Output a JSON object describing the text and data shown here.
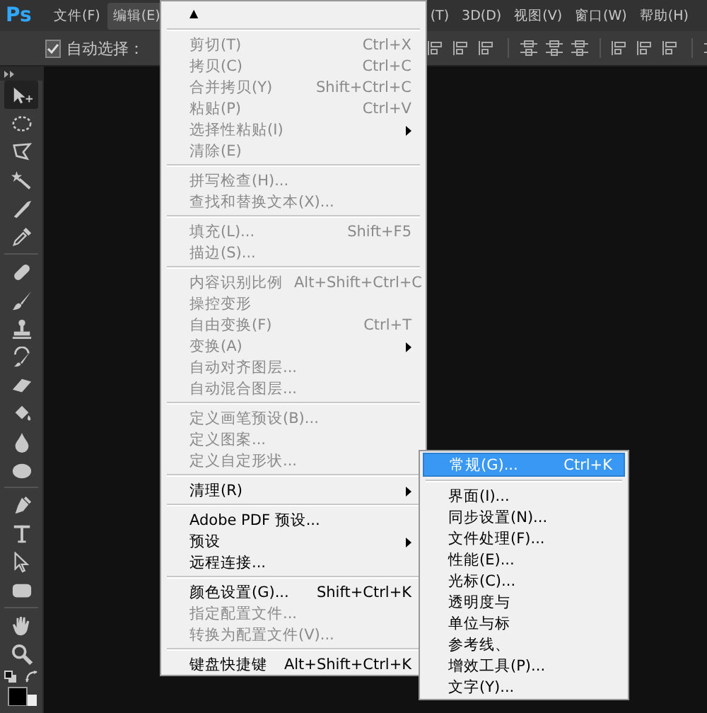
{
  "app_logo": "Ps",
  "menu_bar": {
    "left": [
      {
        "label": "文件(F)",
        "selected": false
      },
      {
        "label": "编辑(E)",
        "selected": true
      }
    ],
    "right": [
      {
        "label": "(T)",
        "selected": false
      },
      {
        "label": "3D(D)",
        "selected": false
      },
      {
        "label": "视图(V)",
        "selected": false
      },
      {
        "label": "窗口(W)",
        "selected": false
      },
      {
        "label": "帮助(H)",
        "selected": false
      }
    ]
  },
  "options_bar": {
    "auto_select": {
      "label": "自动选择：",
      "checked": true
    }
  },
  "tools": [
    {
      "kind": "move",
      "selected": true
    },
    {
      "kind": "marquee",
      "selected": false
    },
    {
      "kind": "lasso",
      "selected": false
    },
    {
      "kind": "wand",
      "selected": false
    },
    {
      "kind": "knife",
      "selected": false
    },
    {
      "kind": "eyedropper",
      "selected": false
    },
    {
      "kind": "separator"
    },
    {
      "kind": "bandage",
      "selected": false
    },
    {
      "kind": "brush",
      "selected": false
    },
    {
      "kind": "stamp",
      "selected": false
    },
    {
      "kind": "history",
      "selected": false
    },
    {
      "kind": "eraser",
      "selected": false
    },
    {
      "kind": "bucket",
      "selected": false
    },
    {
      "kind": "drop",
      "selected": false
    },
    {
      "kind": "sponge",
      "selected": false
    },
    {
      "kind": "separator"
    },
    {
      "kind": "pen",
      "selected": false
    },
    {
      "kind": "type",
      "selected": false
    },
    {
      "kind": "pointer",
      "selected": false
    },
    {
      "kind": "shape",
      "selected": false
    },
    {
      "kind": "separator"
    },
    {
      "kind": "hand",
      "selected": false
    },
    {
      "kind": "zoom",
      "selected": false
    }
  ],
  "edit_menu": {
    "scroll_arrow": "▲",
    "items": [
      {
        "kind": "item",
        "label": "剪切(T)",
        "shortcut": "Ctrl+X",
        "disabled": true
      },
      {
        "kind": "item",
        "label": "拷贝(C)",
        "shortcut": "Ctrl+C",
        "disabled": true
      },
      {
        "kind": "item",
        "label": "合并拷贝(Y)",
        "shortcut": "Shift+Ctrl+C",
        "disabled": true
      },
      {
        "kind": "item",
        "label": "粘贴(P)",
        "shortcut": "Ctrl+V",
        "disabled": true
      },
      {
        "kind": "submenu",
        "label": "选择性粘贴(I)",
        "disabled": true
      },
      {
        "kind": "item",
        "label": "清除(E)",
        "disabled": true
      },
      {
        "kind": "separator"
      },
      {
        "kind": "item",
        "label": "拼写检查(H)...",
        "disabled": true
      },
      {
        "kind": "item",
        "label": "查找和替换文本(X)...",
        "disabled": true
      },
      {
        "kind": "separator"
      },
      {
        "kind": "item",
        "label": "填充(L)...",
        "shortcut": "Shift+F5",
        "disabled": true
      },
      {
        "kind": "item",
        "label": "描边(S)...",
        "disabled": true
      },
      {
        "kind": "separator"
      },
      {
        "kind": "item",
        "label": "内容识别比例",
        "shortcut": "Alt+Shift+Ctrl+C",
        "disabled": true
      },
      {
        "kind": "item",
        "label": "操控变形",
        "disabled": true
      },
      {
        "kind": "item",
        "label": "自由变换(F)",
        "shortcut": "Ctrl+T",
        "disabled": true
      },
      {
        "kind": "submenu",
        "label": "变换(A)",
        "disabled": true
      },
      {
        "kind": "item",
        "label": "自动对齐图层...",
        "disabled": true
      },
      {
        "kind": "item",
        "label": "自动混合图层...",
        "disabled": true
      },
      {
        "kind": "separator"
      },
      {
        "kind": "item",
        "label": "定义画笔预设(B)...",
        "disabled": true
      },
      {
        "kind": "item",
        "label": "定义图案...",
        "disabled": true
      },
      {
        "kind": "item",
        "label": "定义自定形状...",
        "disabled": true
      },
      {
        "kind": "separator"
      },
      {
        "kind": "submenu",
        "label": "清理(R)",
        "disabled": false
      },
      {
        "kind": "separator"
      },
      {
        "kind": "item",
        "label": "Adobe PDF 预设...",
        "disabled": false
      },
      {
        "kind": "submenu",
        "label": "预设",
        "disabled": false
      },
      {
        "kind": "item",
        "label": "远程连接...",
        "disabled": false
      },
      {
        "kind": "separator"
      },
      {
        "kind": "item",
        "label": "颜色设置(G)...",
        "shortcut": "Shift+Ctrl+K",
        "disabled": false
      },
      {
        "kind": "item",
        "label": "指定配置文件...",
        "disabled": true
      },
      {
        "kind": "item",
        "label": "转换为配置文件(V)...",
        "disabled": true
      },
      {
        "kind": "separator"
      },
      {
        "kind": "item",
        "label": "键盘快捷键",
        "shortcut": "Alt+Shift+Ctrl+K",
        "disabled": false
      }
    ]
  },
  "preferences_submenu": {
    "items": [
      {
        "kind": "item",
        "label": "常规(G)...",
        "shortcut": "Ctrl+K",
        "selected": true
      },
      {
        "kind": "separator"
      },
      {
        "kind": "item",
        "label": "界面(I)...",
        "selected": false
      },
      {
        "kind": "item",
        "label": "同步设置(N)...",
        "selected": false
      },
      {
        "kind": "item",
        "label": "文件处理(F)...",
        "selected": false
      },
      {
        "kind": "item",
        "label": "性能(E)...",
        "selected": false
      },
      {
        "kind": "item",
        "label": "光标(C)...",
        "selected": false
      },
      {
        "kind": "item",
        "label": "透明度与",
        "selected": false
      },
      {
        "kind": "item",
        "label": "单位与标",
        "selected": false
      },
      {
        "kind": "item",
        "label": "参考线、",
        "selected": false
      },
      {
        "kind": "item",
        "label": "增效工具(P)...",
        "selected": false
      },
      {
        "kind": "item",
        "label": "文字(Y)...",
        "selected": false
      }
    ]
  }
}
